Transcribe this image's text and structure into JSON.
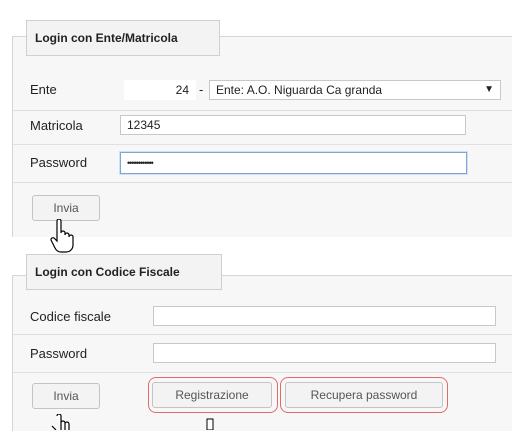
{
  "section1": {
    "title": "Login con Ente/Matricola",
    "ente": {
      "label": "Ente",
      "code": "24",
      "dash": "-",
      "selected": "Ente: A.O. Niguarda Ca granda"
    },
    "matricola": {
      "label": "Matricola",
      "value": "12345"
    },
    "password": {
      "label": "Password",
      "value": "••••••••••••"
    },
    "submit_label": "Invia"
  },
  "section2": {
    "title": "Login con Codice Fiscale",
    "codice": {
      "label": "Codice fiscale",
      "value": ""
    },
    "password": {
      "label": "Password",
      "value": ""
    },
    "submit_label": "Invia",
    "register_label": "Registrazione",
    "recover_label": "Recupera password"
  },
  "colors": {
    "highlight_ring": "#e06b6b",
    "focus_border": "#7aa7d8"
  },
  "icons": {
    "cursor": "hand-pointer-icon",
    "text_cursor": "i-beam-icon"
  }
}
